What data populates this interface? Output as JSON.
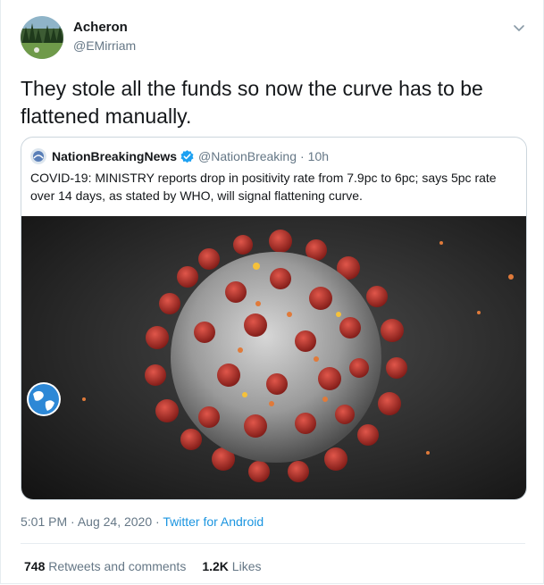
{
  "author": {
    "name": "Acheron",
    "handle": "@EMirriam"
  },
  "tweet": {
    "text": "They stole all the funds so now the curve has to be flattened manually."
  },
  "quoted": {
    "name": "NationBreakingNews",
    "handle": "@NationBreaking",
    "sep": "·",
    "time": "10h",
    "text": "COVID-19: MINISTRY reports drop in positivity rate from 7.9pc to 6pc; says 5pc rate over 14 days, as stated by WHO, will signal flattening curve."
  },
  "meta": {
    "time": "5:01 PM",
    "sep1": "·",
    "date": "Aug 24, 2020",
    "sep2": "·",
    "source": "Twitter for Android"
  },
  "stats": {
    "retweets_count": "748",
    "retweets_label": "Retweets and comments",
    "likes_count": "1.2K",
    "likes_label": "Likes"
  },
  "colors": {
    "link": "#1b95e0",
    "muted": "#657786",
    "text": "#14171a",
    "verified": "#1da1f2",
    "virus_spike": "#b52a25"
  },
  "icons": [
    "chevron-down-icon",
    "verified-badge-icon",
    "globe-logo-icon"
  ]
}
